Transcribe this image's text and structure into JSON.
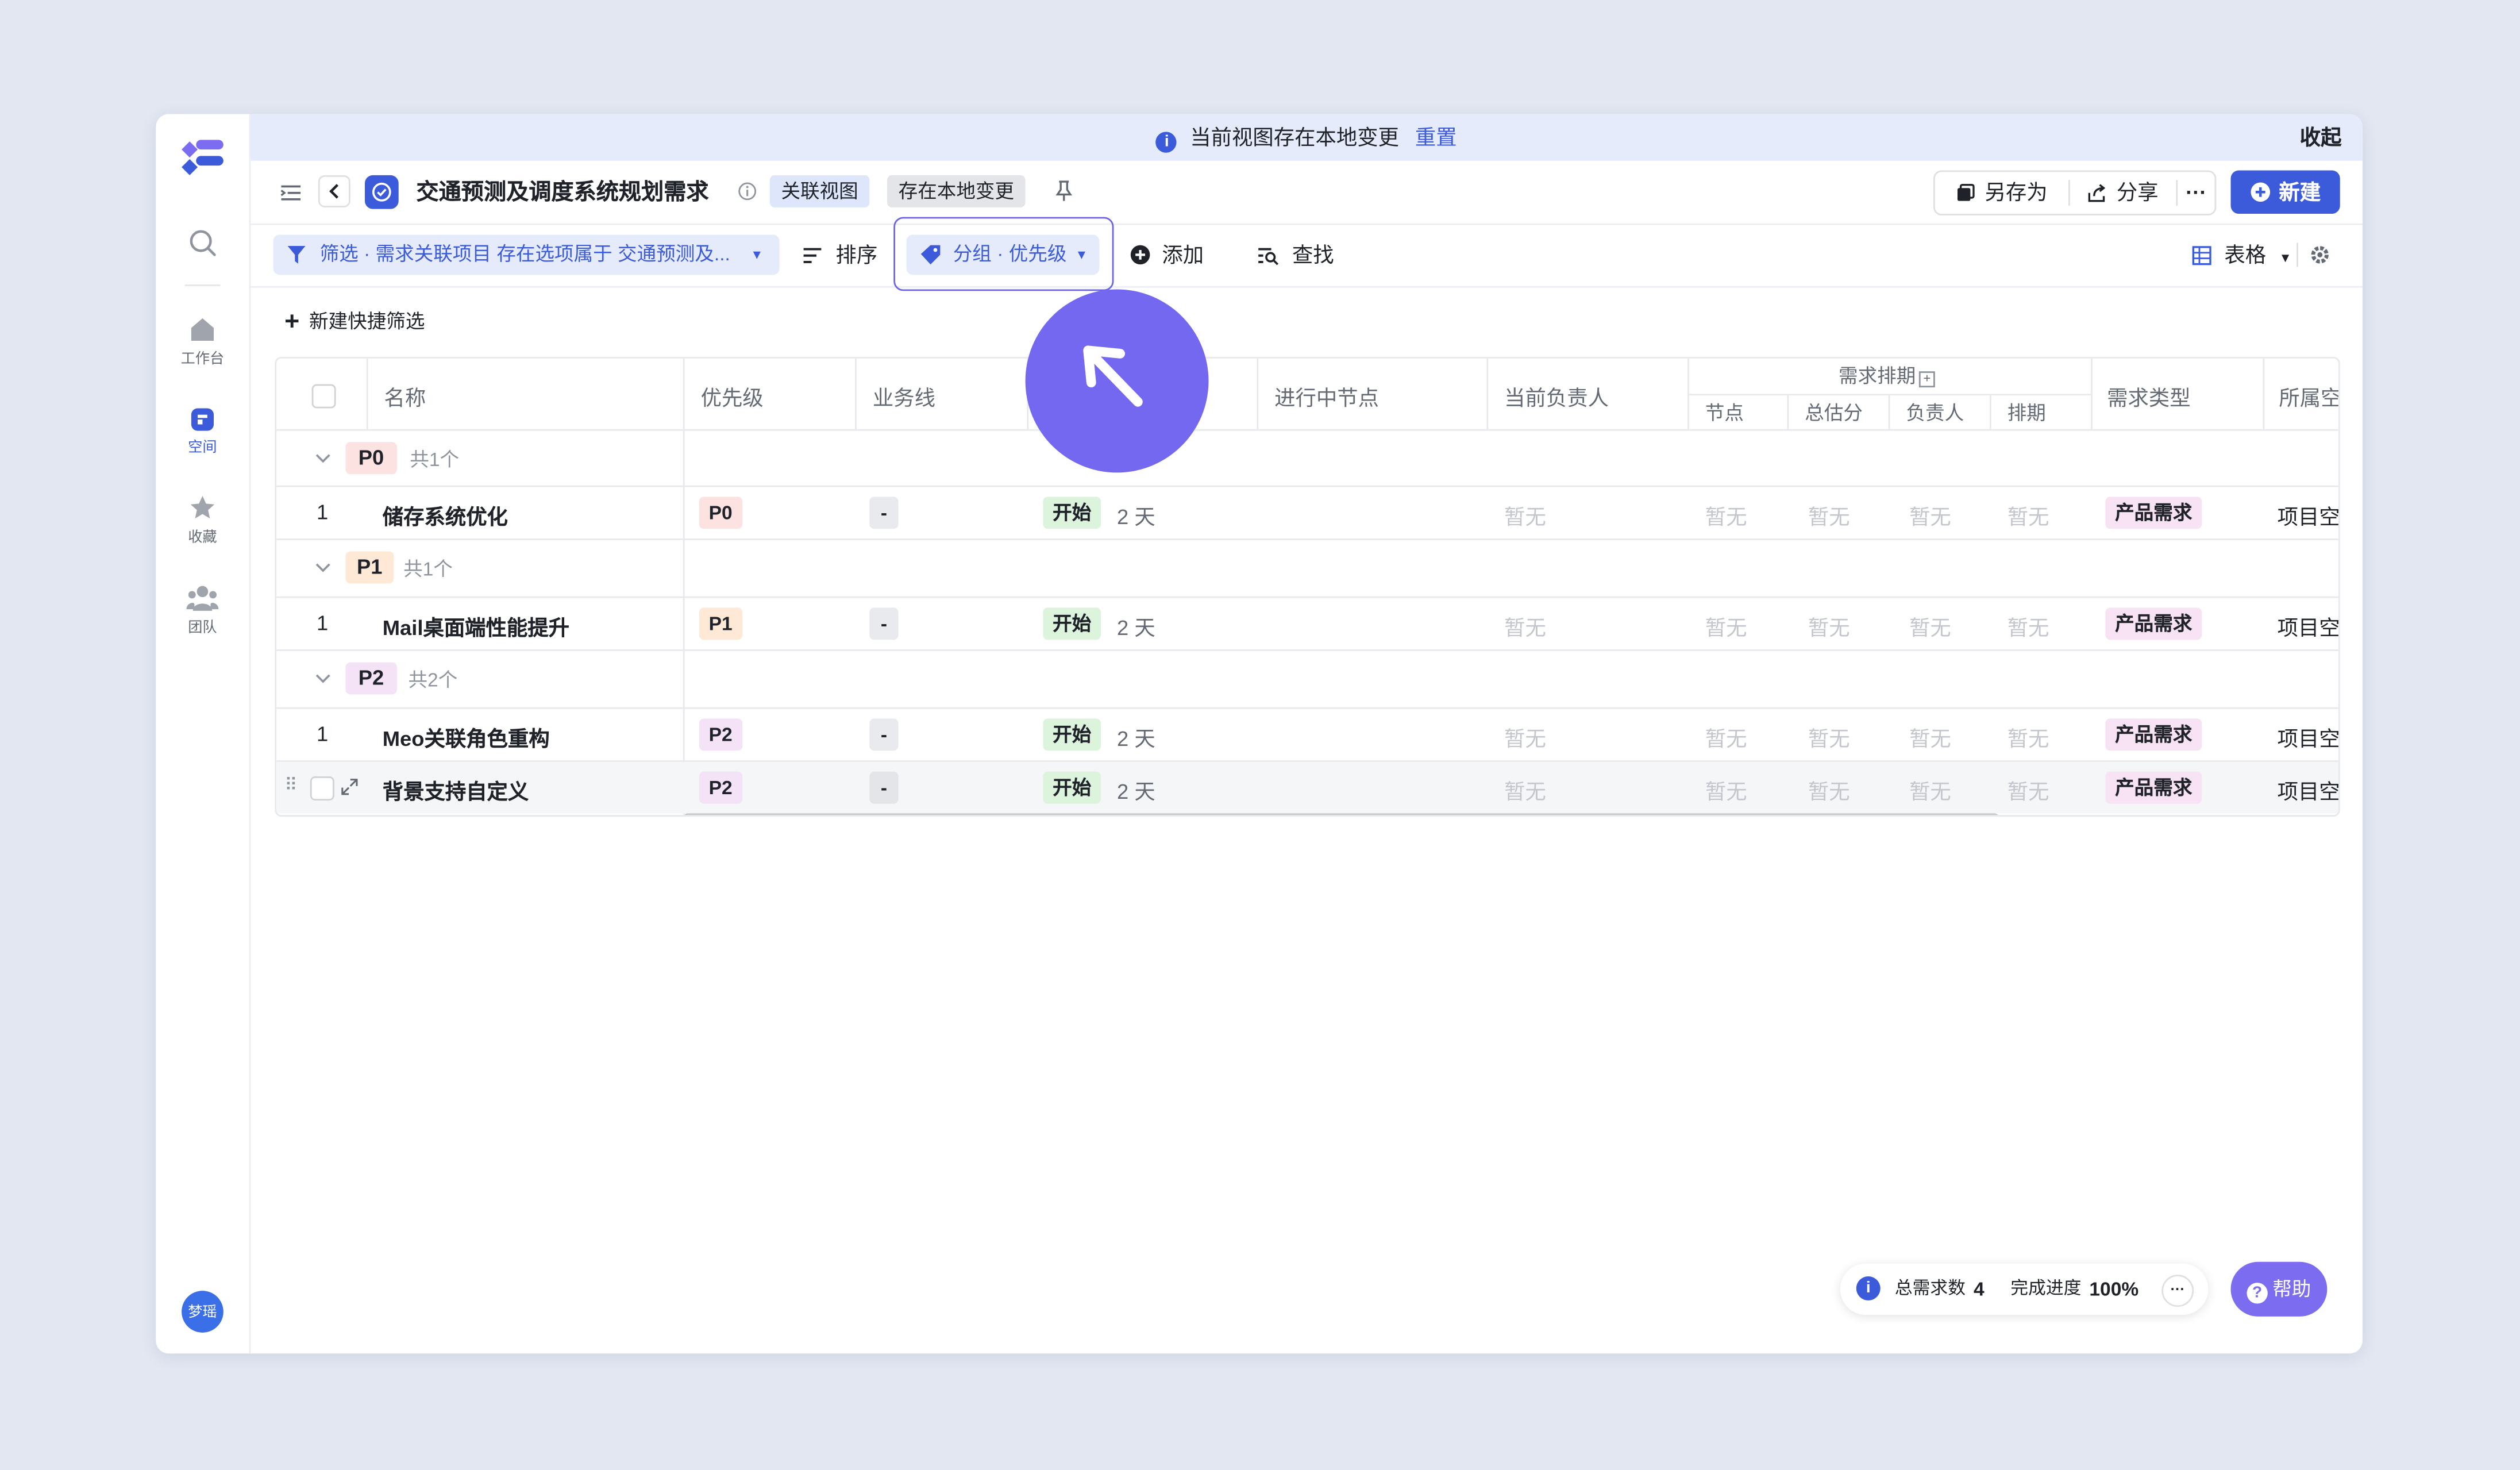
{
  "banner": {
    "message": "当前视图存在本地变更",
    "reset_label": "重置",
    "collapse_label": "收起"
  },
  "sidebar": {
    "items": [
      {
        "label": "工作台",
        "icon": "home-icon"
      },
      {
        "label": "空间",
        "icon": "space-icon"
      },
      {
        "label": "收藏",
        "icon": "star-icon"
      },
      {
        "label": "团队",
        "icon": "team-icon"
      }
    ],
    "avatar_text": "梦瑶"
  },
  "titlebar": {
    "title": "交通预测及调度系统规划需求",
    "tag_linked_view": "关联视图",
    "tag_local_change": "存在本地变更",
    "save_as_label": "另存为",
    "share_label": "分享",
    "new_label": "新建"
  },
  "toolbar": {
    "filter_label": "筛选 · 需求关联项目 存在选项属于 交通预测及...",
    "sort_label": "排序",
    "group_label": "分组 · 优先级",
    "add_label": "添加",
    "find_label": "查找",
    "view_label": "表格"
  },
  "quick_filter": {
    "label": "新建快捷筛选"
  },
  "table": {
    "headers": {
      "name": "名称",
      "priority": "优先级",
      "business_line": "业务线",
      "node_in_progress": "进行中节点",
      "current_owner": "当前负责人",
      "schedule_group": "需求排期",
      "node": "节点",
      "total_estimate": "总估分",
      "owner": "负责人",
      "schedule": "排期",
      "req_type": "需求类型",
      "space": "所属空"
    },
    "groups": [
      {
        "label": "P0",
        "count": "共1个",
        "rows": [
          {
            "index": "1",
            "name": "储存系统优化",
            "priority": "P0",
            "business_line": "-",
            "status": "开始",
            "duration": "2 天",
            "owner": "暂无",
            "node": "暂无",
            "estimate": "暂无",
            "assignee": "暂无",
            "schedule": "暂无",
            "type": "产品需求",
            "space": "项目空"
          }
        ]
      },
      {
        "label": "P1",
        "count": "共1个",
        "rows": [
          {
            "index": "1",
            "name": "Mail桌面端性能提升",
            "priority": "P1",
            "business_line": "-",
            "status": "开始",
            "duration": "2 天",
            "owner": "暂无",
            "node": "暂无",
            "estimate": "暂无",
            "assignee": "暂无",
            "schedule": "暂无",
            "type": "产品需求",
            "space": "项目空"
          }
        ]
      },
      {
        "label": "P2",
        "count": "共2个",
        "rows": [
          {
            "index": "1",
            "name": "Meo关联角色重构",
            "priority": "P2",
            "business_line": "-",
            "status": "开始",
            "duration": "2 天",
            "owner": "暂无",
            "node": "暂无",
            "estimate": "暂无",
            "assignee": "暂无",
            "schedule": "暂无",
            "type": "产品需求",
            "space": "项目空"
          },
          {
            "index": "",
            "name": "背景支持自定义",
            "priority": "P2",
            "business_line": "-",
            "status": "开始",
            "duration": "2 天",
            "owner": "暂无",
            "node": "暂无",
            "estimate": "暂无",
            "assignee": "暂无",
            "schedule": "暂无",
            "type": "产品需求",
            "space": "项目空"
          }
        ]
      }
    ]
  },
  "footer": {
    "total_label": "总需求数",
    "total_value": "4",
    "progress_label": "完成进度",
    "progress_value": "100%",
    "help_label": "帮助"
  },
  "colors": {
    "accent": "#3b5bdb",
    "cursor_badge": "#7467f0",
    "p0_bg": "#fde2e2",
    "p1_bg": "#fde9d6",
    "p2_bg": "#f4e3f7",
    "status_bg": "#dcf3dc",
    "type_bg": "#f7e3f3"
  }
}
